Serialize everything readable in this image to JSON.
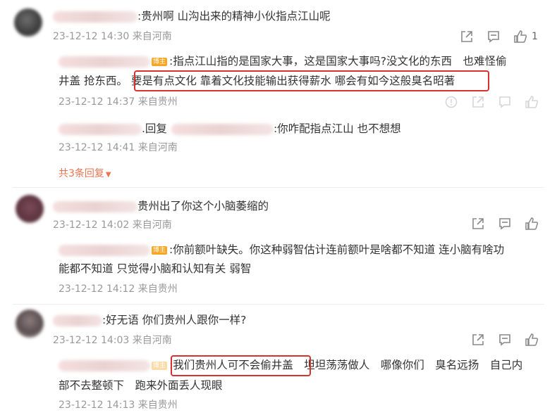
{
  "badge_label": "博主",
  "comments": [
    {
      "text": ":贵州啊 山沟出来的精神小伙指点江山呢",
      "meta": "23-12-12 14:30 来自河南",
      "like_count": "1",
      "replies": [
        {
          "line1_a": ":指点江山指的是国家大事，这是国家大事吗?没文化的东西　也难怪偷",
          "line2_a": "井盖 抢东西。",
          "line2_b": "要是有点文化 靠着文化技能输出获得薪水 哪会有如今这般臭名昭著",
          "meta": "23-12-12 14:37 来自贵州"
        },
        {
          "mid": ".回复",
          "text": ":你咋配指点江山 也不想想",
          "meta": "23-12-12 14:41 来自河南"
        }
      ],
      "expand_label": "共3条回复"
    },
    {
      "text": "贵州出了你这个小脑萎缩的",
      "meta": "23-12-12 14:02 来自河南",
      "replies": [
        {
          "line1": ":你前额叶缺失。你这种弱智估计连前额叶是啥都不知道 连小脑有啥功",
          "line2": "能都不知道 只觉得小脑和认知有关 弱智",
          "meta": "23-12-12 14:12 来自贵州"
        }
      ]
    },
    {
      "text": ":好无语 你们贵州人跟你一样?",
      "meta": "23-12-12 14:03 来自河南",
      "replies": [
        {
          "line1_a": ":我们贵州人可不会偷井盖",
          "line1_b": "坦坦荡荡做人　哪像你们　臭名远扬　自己内",
          "line2": "部不去整顿下　跑来外面丢人现眼",
          "meta": "23-12-12 14:13 来自贵州"
        }
      ]
    }
  ],
  "colors": {
    "meta": "#999999",
    "highlight_border": "#d83131",
    "badge": "#f6a623",
    "link": "#eb7350"
  }
}
